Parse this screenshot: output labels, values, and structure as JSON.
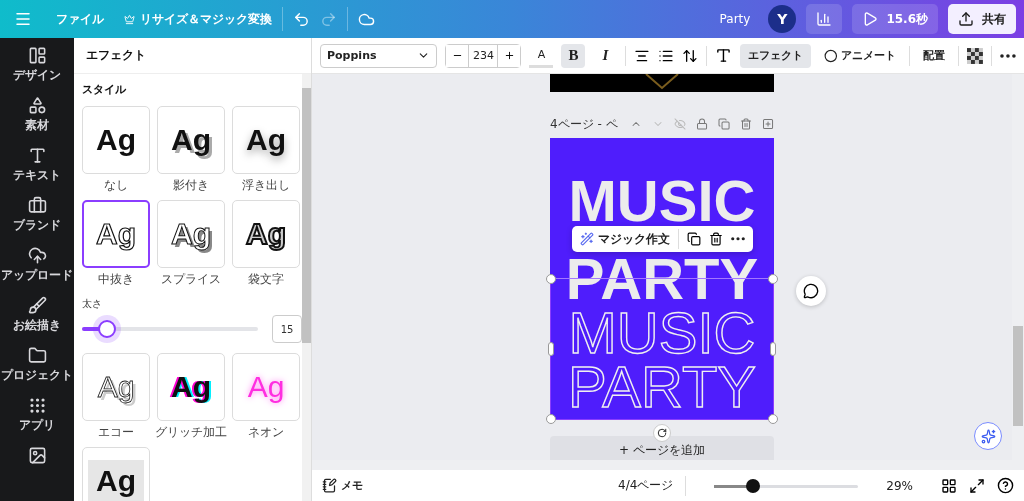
{
  "topbar": {
    "file": "ファイル",
    "resize": "リサイズ＆マジック変換",
    "title": "Party",
    "avatar": "Y",
    "play": "15.6秒",
    "share": "共有"
  },
  "sidebar": {
    "items": [
      {
        "kind": "design",
        "label": "デザイン"
      },
      {
        "kind": "elements",
        "label": "素材"
      },
      {
        "kind": "text",
        "label": "テキスト"
      },
      {
        "kind": "brand",
        "label": "ブランド"
      },
      {
        "kind": "upload",
        "label": "アップロード"
      },
      {
        "kind": "draw",
        "label": "お絵描き"
      },
      {
        "kind": "project",
        "label": "プロジェクト"
      },
      {
        "kind": "apps",
        "label": "アプリ"
      },
      {
        "kind": "photos"
      }
    ]
  },
  "panel": {
    "title": "エフェクト",
    "section": "スタイル",
    "styles_top": [
      {
        "kind": "none",
        "preview": "Ag",
        "label": "なし",
        "selected": false
      },
      {
        "kind": "shadow",
        "preview": "Ag",
        "label": "影付き",
        "selected": false
      },
      {
        "kind": "lift",
        "preview": "Ag",
        "label": "浮き出し",
        "selected": false
      },
      {
        "kind": "hollow",
        "preview": "Ag",
        "label": "中抜き",
        "selected": true
      },
      {
        "kind": "splice",
        "preview": "Ag",
        "label": "スプライス",
        "selected": false
      },
      {
        "kind": "outline",
        "preview": "Ag",
        "label": "袋文字",
        "selected": false
      }
    ],
    "slider": {
      "label": "太さ",
      "level": 0.14,
      "value": "15"
    },
    "styles_bottom": [
      {
        "kind": "echo",
        "preview": "Ag",
        "label": "エコー",
        "selected": false
      },
      {
        "kind": "glitch",
        "preview": "Ag",
        "label": "グリッチ加工",
        "selected": false
      },
      {
        "kind": "neon",
        "preview": "Ag",
        "label": "ネオン",
        "selected": false
      },
      {
        "kind": "background",
        "preview": "Ag",
        "selected": false
      }
    ]
  },
  "toolbar": {
    "font": "Poppins",
    "size": "234",
    "color_glyph": "A",
    "bold": {
      "glyph": "B",
      "selected": true
    },
    "italic": {
      "glyph": "I",
      "selected": false
    },
    "effects": {
      "label": "エフェクト",
      "selected": true
    },
    "animate": "アニメート",
    "position": "配置"
  },
  "canvas": {
    "page_label": "4ページ - ペ",
    "magic_write": "マジック作文",
    "lines": [
      {
        "kind": "solid",
        "text": "MUSIC"
      },
      {
        "kind": "solid",
        "text": "PARTY"
      },
      {
        "kind": "outline",
        "text": "MUSIC"
      },
      {
        "kind": "outline",
        "text": "PARTY"
      }
    ],
    "add_page": "+ ページを追加"
  },
  "bottombar": {
    "notes": "メモ",
    "pages": "4/4ページ",
    "zoom": {
      "level": 0.27
    },
    "zoom_text": "29%"
  }
}
